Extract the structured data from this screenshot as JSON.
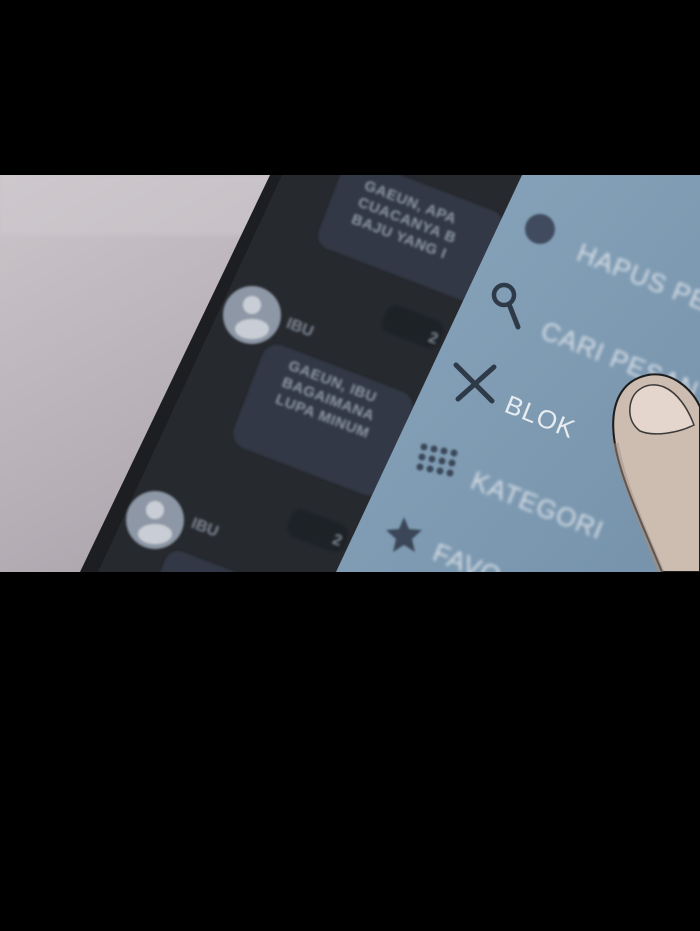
{
  "chat": {
    "top_bubble_lines": [
      "GAEUN, APA",
      "CUACANYA B",
      "BAJU YANG I"
    ],
    "sender_1": "IBU",
    "sender_1_time": "2",
    "bubble_1_lines": [
      "GAEUN, IBU",
      "BAGAIMANA",
      "LUPA MINUM"
    ],
    "sender_2": "IBU",
    "sender_2_time": "2"
  },
  "menu": {
    "items": [
      {
        "label": "HAPUS PE",
        "icon": "circle-icon"
      },
      {
        "label": "CARI PESAN",
        "icon": "search-icon"
      },
      {
        "label": "BLOK",
        "icon": "close-icon"
      },
      {
        "label": "KATEGORI",
        "icon": "grid-icon"
      },
      {
        "label": "FAVO",
        "icon": "star-icon"
      }
    ]
  },
  "colors": {
    "letterbox": "#000000",
    "menu_bg": "#7f9cb4",
    "phone_screen": "#25282d",
    "skin": "#cdbcb0"
  }
}
